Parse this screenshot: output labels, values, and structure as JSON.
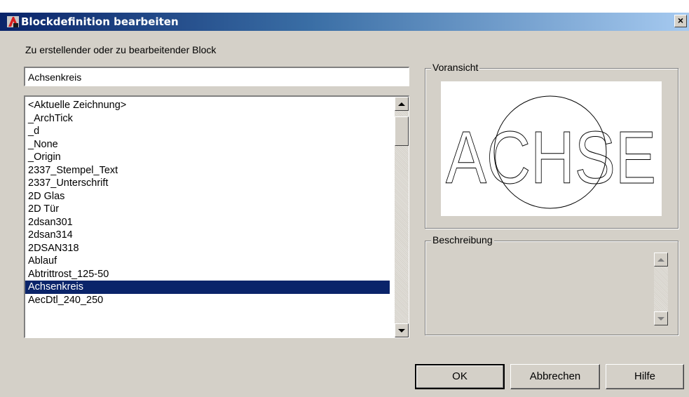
{
  "window": {
    "title": "Blockdefinition bearbeiten",
    "close_glyph": "×"
  },
  "prompt_label": "Zu erstellender oder zu bearbeitender Block",
  "block_name": {
    "value": "Achsenkreis"
  },
  "block_list": {
    "items": [
      "<Aktuelle Zeichnung>",
      "_ArchTick",
      "_d",
      "_None",
      "_Origin",
      "2337_Stempel_Text",
      "2337_Unterschrift",
      "2D Glas",
      "2D Tür",
      "2dsan301",
      "2dsan314",
      "2DSAN318",
      "Ablauf",
      "Abtrittrost_125-50",
      "Achsenkreis",
      "AecDtl_240_250"
    ],
    "selected_index": 14
  },
  "preview": {
    "label": "Voransicht",
    "text": "ACHSE"
  },
  "description": {
    "label": "Beschreibung",
    "value": ""
  },
  "buttons": {
    "ok": "OK",
    "cancel": "Abbrechen",
    "help": "Hilfe"
  }
}
